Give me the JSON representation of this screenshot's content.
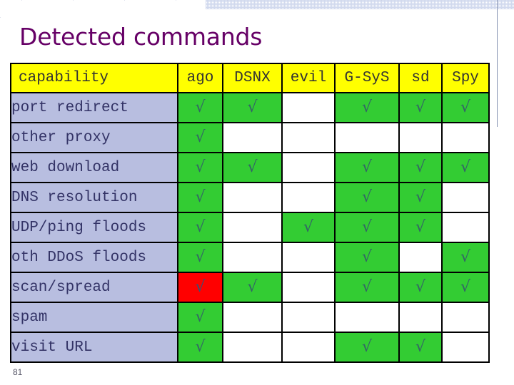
{
  "slide": {
    "title": "Detected commands",
    "page_number": "81",
    "title_color": "#660066"
  },
  "colors": {
    "header_bg": "#ffff00",
    "row_label_bg": "#b8bee0",
    "cell_on": "#33cc33",
    "cell_alert": "#ff0000",
    "cell_off": "#ffffff",
    "border": "#000000",
    "tick_glyph": "√"
  },
  "table": {
    "columns": [
      {
        "key": "capability",
        "label": "capability"
      },
      {
        "key": "ago",
        "label": "ago"
      },
      {
        "key": "dsnx",
        "label": "DSNX"
      },
      {
        "key": "evil",
        "label": "evil"
      },
      {
        "key": "gsys",
        "label": "G-SyS"
      },
      {
        "key": "sd",
        "label": "sd"
      },
      {
        "key": "spy",
        "label": "Spy"
      }
    ],
    "rows": [
      {
        "label": "port redirect",
        "cells": [
          {
            "state": "on",
            "mark": "√"
          },
          {
            "state": "on",
            "mark": "√"
          },
          {
            "state": "off",
            "mark": ""
          },
          {
            "state": "on",
            "mark": "√"
          },
          {
            "state": "on",
            "mark": "√"
          },
          {
            "state": "on",
            "mark": "√"
          }
        ]
      },
      {
        "label": "other proxy",
        "cells": [
          {
            "state": "on",
            "mark": "√"
          },
          {
            "state": "off",
            "mark": ""
          },
          {
            "state": "off",
            "mark": ""
          },
          {
            "state": "off",
            "mark": ""
          },
          {
            "state": "off",
            "mark": ""
          },
          {
            "state": "off",
            "mark": ""
          }
        ]
      },
      {
        "label": "web download",
        "cells": [
          {
            "state": "on",
            "mark": "√"
          },
          {
            "state": "on",
            "mark": "√"
          },
          {
            "state": "off",
            "mark": ""
          },
          {
            "state": "on",
            "mark": "√"
          },
          {
            "state": "on",
            "mark": "√"
          },
          {
            "state": "on",
            "mark": "√"
          }
        ]
      },
      {
        "label": "DNS resolution",
        "cells": [
          {
            "state": "on",
            "mark": "√"
          },
          {
            "state": "off",
            "mark": ""
          },
          {
            "state": "off",
            "mark": ""
          },
          {
            "state": "on",
            "mark": "√"
          },
          {
            "state": "on",
            "mark": "√"
          },
          {
            "state": "off",
            "mark": ""
          }
        ]
      },
      {
        "label": "UDP/ping floods",
        "cells": [
          {
            "state": "on",
            "mark": "√"
          },
          {
            "state": "off",
            "mark": ""
          },
          {
            "state": "on",
            "mark": "√"
          },
          {
            "state": "on",
            "mark": "√"
          },
          {
            "state": "on",
            "mark": "√"
          },
          {
            "state": "off",
            "mark": ""
          }
        ]
      },
      {
        "label": "oth DDoS floods",
        "cells": [
          {
            "state": "on",
            "mark": "√"
          },
          {
            "state": "off",
            "mark": ""
          },
          {
            "state": "off",
            "mark": ""
          },
          {
            "state": "on",
            "mark": "√"
          },
          {
            "state": "off",
            "mark": ""
          },
          {
            "state": "on",
            "mark": "√"
          }
        ]
      },
      {
        "label": "scan/spread",
        "cells": [
          {
            "state": "alert",
            "mark": "√"
          },
          {
            "state": "on",
            "mark": "√"
          },
          {
            "state": "off",
            "mark": ""
          },
          {
            "state": "on",
            "mark": "√"
          },
          {
            "state": "on",
            "mark": "√"
          },
          {
            "state": "on",
            "mark": "√"
          }
        ]
      },
      {
        "label": "spam",
        "cells": [
          {
            "state": "on",
            "mark": "√"
          },
          {
            "state": "off",
            "mark": ""
          },
          {
            "state": "off",
            "mark": ""
          },
          {
            "state": "off",
            "mark": ""
          },
          {
            "state": "off",
            "mark": ""
          },
          {
            "state": "off",
            "mark": ""
          }
        ]
      },
      {
        "label": "visit URL",
        "cells": [
          {
            "state": "on",
            "mark": "√"
          },
          {
            "state": "off",
            "mark": ""
          },
          {
            "state": "off",
            "mark": ""
          },
          {
            "state": "on",
            "mark": "√"
          },
          {
            "state": "on",
            "mark": "√"
          },
          {
            "state": "off",
            "mark": ""
          }
        ]
      }
    ]
  }
}
